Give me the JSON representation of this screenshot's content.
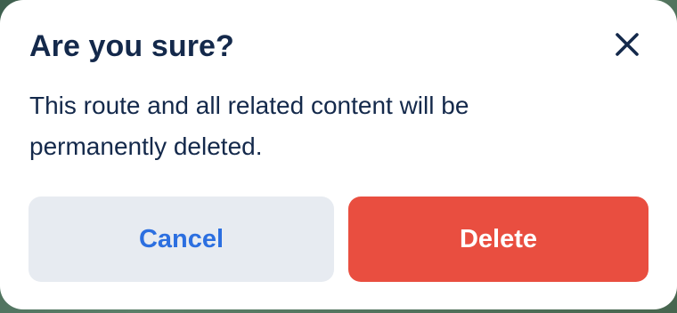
{
  "dialog": {
    "title": "Are you sure?",
    "message": "This route and all related content will be permanently deleted.",
    "close_icon": "close-icon",
    "cancel_label": "Cancel",
    "delete_label": "Delete"
  },
  "colors": {
    "title_text": "#14294b",
    "cancel_bg": "#e7ebf1",
    "cancel_text": "#2c6fe0",
    "delete_bg": "#e94e40",
    "delete_text": "#ffffff"
  }
}
